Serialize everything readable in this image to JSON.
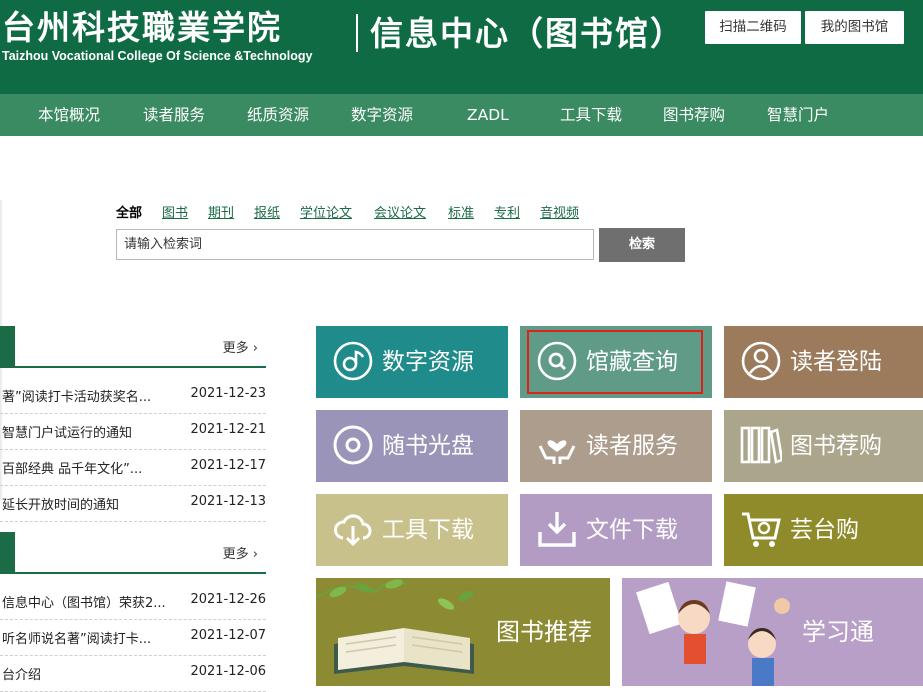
{
  "header": {
    "logo_cn": "台州科技職業学院",
    "logo_en": "Taizhou Vocational College Of Science &Technology",
    "center_name": "信息中心（图书馆）",
    "btn_qr": "扫描二维码",
    "btn_my": "我的图书馆"
  },
  "nav": {
    "items": [
      "本馆概况",
      "读者服务",
      "纸质资源",
      "数字资源",
      "ZADL",
      "工具下载",
      "图书荐购",
      "智慧门户"
    ]
  },
  "search": {
    "tabs": [
      "全部",
      "图书",
      "期刊",
      "报纸",
      "学位论文",
      "会议论文",
      "标准",
      "专利",
      "音视频"
    ],
    "active_tab": "全部",
    "placeholder": "请输入检索词",
    "button": "检索"
  },
  "news_sections": [
    {
      "more": "更多",
      "items": [
        {
          "title": "著”阅读打卡活动获奖名...",
          "date": "2021-12-23"
        },
        {
          "title": "智慧门户试运行的通知",
          "date": "2021-12-21"
        },
        {
          "title": "百部经典 品千年文化”...",
          "date": "2021-12-17"
        },
        {
          "title": "延长开放时间的通知",
          "date": "2021-12-13"
        }
      ]
    },
    {
      "more": "更多",
      "items": [
        {
          "title": "信息中心（图书馆）荣获2...",
          "date": "2021-12-26"
        },
        {
          "title": "听名师说名著”阅读打卡...",
          "date": "2021-12-07"
        },
        {
          "title": "台介绍",
          "date": "2021-12-06"
        }
      ]
    }
  ],
  "tiles": [
    {
      "label": "数字资源",
      "icon": "digital-resource-icon",
      "color": "#1f8b8a"
    },
    {
      "label": "馆藏查询",
      "icon": "search-icon",
      "color": "#5f9b86"
    },
    {
      "label": "读者登陆",
      "icon": "user-icon",
      "color": "#9c7a5c"
    },
    {
      "label": "随书光盘",
      "icon": "disc-icon",
      "color": "#9a95b8"
    },
    {
      "label": "读者服务",
      "icon": "heart-hands-icon",
      "color": "#ac9d8c"
    },
    {
      "label": "图书荐购",
      "icon": "books-icon",
      "color": "#aba58c"
    },
    {
      "label": "工具下载",
      "icon": "cloud-download-icon",
      "color": "#c9c18c"
    },
    {
      "label": "文件下载",
      "icon": "file-download-icon",
      "color": "#b29cc4"
    },
    {
      "label": "芸台购",
      "icon": "shopping-cart-icon",
      "color": "#8f8a2a"
    }
  ],
  "banners": [
    {
      "label": "图书推荐",
      "color": "#8c8a33"
    },
    {
      "label": "学习通",
      "color": "#b79fc8"
    }
  ],
  "highlighted_tile": "馆藏查询"
}
